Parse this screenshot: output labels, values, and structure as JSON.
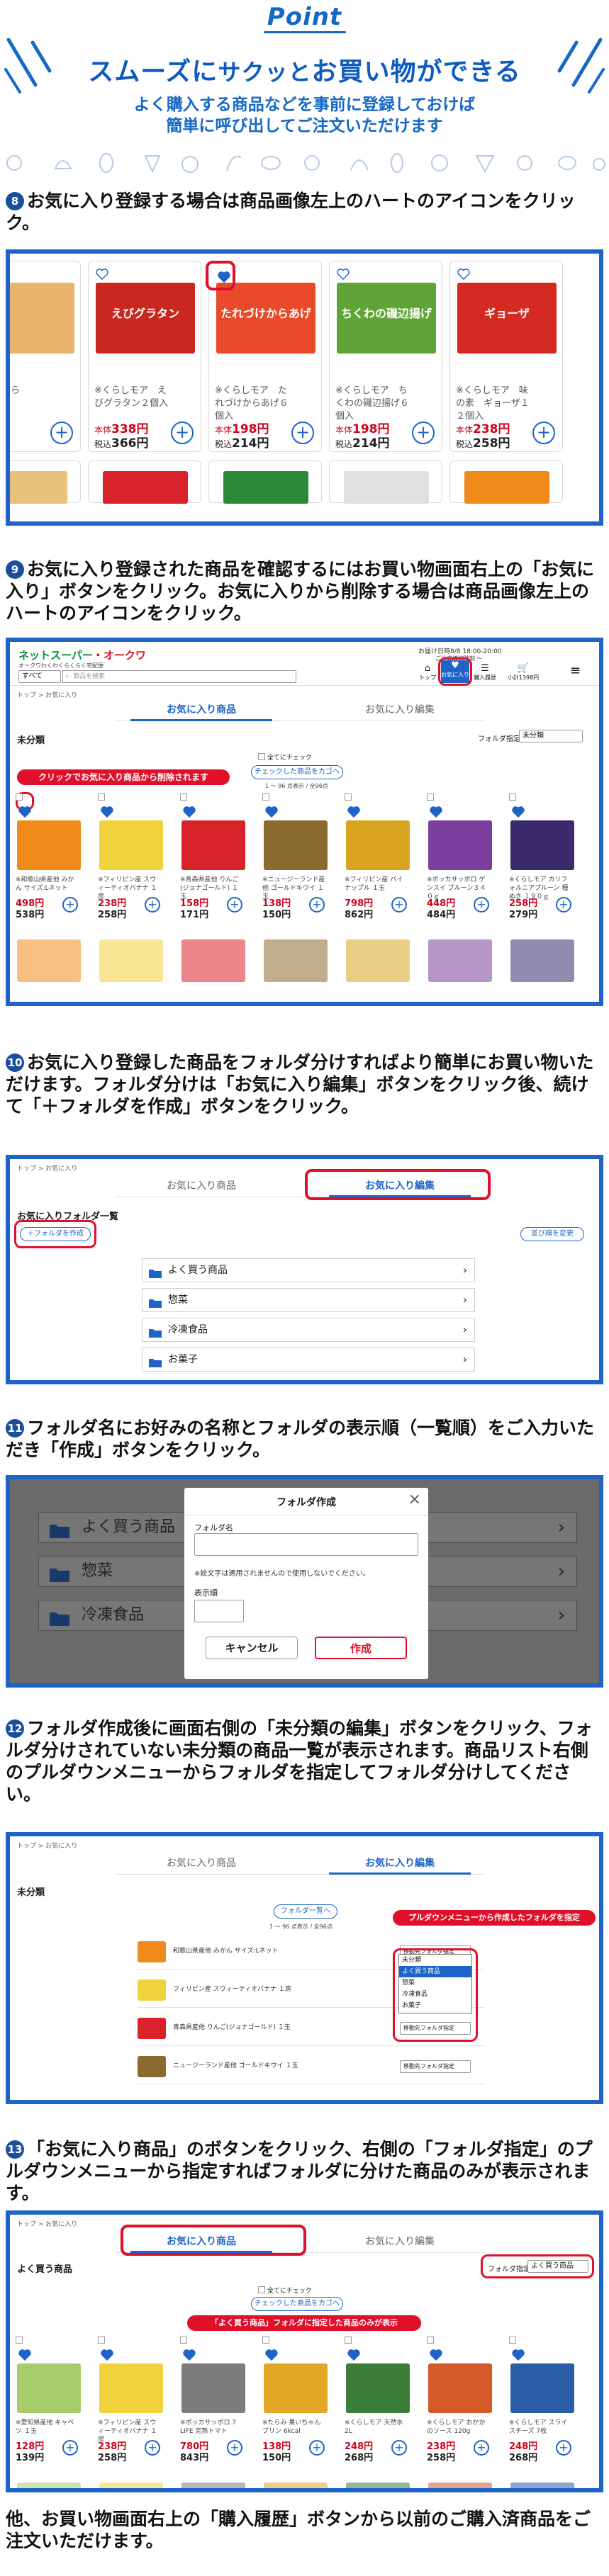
{
  "hero": {
    "point": "Point",
    "title_a": "スムーズに",
    "title_b": "サクッ",
    "title_c": "と",
    "title_d": "お買い物ができる",
    "sub1": "よく購入する商品などを事前に登録しておけば",
    "sub2": "簡単に呼び出してご注文いただけます"
  },
  "step8": {
    "num": "8",
    "text": "お気に入り登録する場合は商品画像左上のハートのアイコンをクリック。",
    "products": [
      {
        "name": "いか天ぷら",
        "p1": "",
        "p2": "",
        "color": "#e8b36a"
      },
      {
        "name": "※くらしモア　えびグラタン２個入",
        "p1": "338円",
        "p2": "366円",
        "color": "#c8281f",
        "img_label": "えびグラタン"
      },
      {
        "name": "※くらしモア　たれづけからあげ６個入",
        "p1": "198円",
        "p2": "214円",
        "color": "#e94a2a",
        "img_label": "たれづけからあげ"
      },
      {
        "name": "※くらしモア　ちくわの磯辺揚げ６個入",
        "p1": "198円",
        "p2": "214円",
        "color": "#5fa436",
        "img_label": "ちくわの磯辺揚げ"
      },
      {
        "name": "※くらしモア　味の素　ギョーザ１２個入",
        "p1": "238円",
        "p2": "258円",
        "color": "#d52a22",
        "img_label": "ギョーザ"
      }
    ],
    "price_label1": "本体",
    "price_label2": "税込"
  },
  "step9": {
    "num": "9",
    "text": "お気に入り登録された商品を確認するにはお買い物画面右上の「お気に入り」ボタンをクリック。お気に入りから削除する場合は商品画像左上のハートのアイコンをクリック。",
    "logo_a": "ネットスーパー",
    "logo_b": "・オークワ",
    "logo_sub": "オークワわくわくらくらく宅配便",
    "delivery": "お届け日時8/8 18:00-20:00",
    "delivery2": "ご注文締切時刻 ～",
    "search_cat": "すべて",
    "search_placeholder": "商品を検索",
    "nav": [
      "トップ",
      "お気に入り",
      "購入履歴",
      "小計1398円"
    ],
    "crumb": "トップ > お気に入り",
    "tab_fav": "お気に入り商品",
    "tab_edit": "お気に入り編集",
    "section": "未分類",
    "folder_label": "フォルダ指定",
    "folder_value": "未分類",
    "check_all": "全てにチェック",
    "add_checked": "チェックした商品をカゴへ",
    "count": "1 ～ 96 点表示 / 全96点",
    "callout": "クリックでお気に入り商品から削除されます",
    "items": [
      {
        "name": "※和歌山県産他 みかん サイズ:Lネット",
        "p1": "498円",
        "p2": "538円",
        "color": "#f08a1a"
      },
      {
        "name": "※フィリピン産 スウィーティオバナナ １房",
        "p1": "238円",
        "p2": "258円",
        "color": "#f2d23c"
      },
      {
        "name": "※青森県産他 りんご(ジョナゴールド) １玉",
        "p1": "158円",
        "p2": "171円",
        "color": "#d8232a"
      },
      {
        "name": "※ニュージーランド産他 ゴールドキウイ １玉",
        "p1": "138円",
        "p2": "150円",
        "color": "#8b6a2f"
      },
      {
        "name": "※フィリピン産 パイナップル １玉",
        "p1": "798円",
        "p2": "862円",
        "color": "#d9a521"
      },
      {
        "name": "※ポッカサッポロ ゲンスイ プルーン３４０ｇ",
        "p1": "448円",
        "p2": "484円",
        "color": "#7a3e9c"
      },
      {
        "name": "※くらしモア カリフォルニアプルーン 種ぬき １９０ｇ",
        "p1": "258円",
        "p2": "279円",
        "color": "#3a2a6e"
      }
    ]
  },
  "step10": {
    "num": "10",
    "text": "お気に入り登録した商品をフォルダ分けすればより簡単にお買い物いただけます。フォルダ分けは「お気に入り編集」ボタンをクリック後、続けて「＋フォルダを作成」ボタンをクリック。",
    "crumb": "トップ > お気に入り",
    "tab_fav": "お気に入り商品",
    "tab_edit": "お気に入り編集",
    "list_title": "お気に入りフォルダ一覧",
    "create": "＋フォルダを作成",
    "order": "並び順を変更",
    "folders": [
      "よく買う商品",
      "惣菜",
      "冷凍食品",
      "お菓子"
    ]
  },
  "step11": {
    "num": "11",
    "text": "フォルダ名にお好みの名称とフォルダの表示順（一覧順）をご入力いただき「作成」ボタンをクリック。",
    "bg_folders": [
      "よく買う商品",
      "惣菜",
      "冷凍食品"
    ],
    "modal_title": "フォルダ作成",
    "field_name": "フォルダ名",
    "note": "※絵文字は適用されませんので使用しないでください。",
    "field_order": "表示順",
    "cancel": "キャンセル",
    "create": "作成"
  },
  "step12": {
    "num": "12",
    "text": "フォルダ作成後に画面右側の「未分類の編集」ボタンをクリック、フォルダ分けされていない未分類の商品一覧が表示されます。商品リスト右側のプルダウンメニューからフォルダを指定してフォルダ分けしてください。",
    "crumb": "トップ > お気に入り",
    "tab_fav": "お気に入り商品",
    "tab_edit": "お気に入り編集",
    "section": "未分類",
    "back": "フォルダ一覧へ",
    "count": "1 ～ 96 点表示 / 全96点",
    "callout": "プルダウンメニューから作成したフォルダを指定",
    "rows": [
      "和歌山県産他 みかん サイズ:Lネット",
      "フィリピン産 スウィーティオバナナ １房",
      "青森県産他 りんご(ジョナゴールド) １玉",
      "ニュージーランド産他 ゴールドキウイ １玉"
    ],
    "row_colors": [
      "#f08a1a",
      "#f2d23c",
      "#d8232a",
      "#8b6a2f"
    ],
    "dropdown_value": "移動先フォルダ指定",
    "dropdown_options": [
      "未分類",
      "よく買う商品",
      "惣菜",
      "冷凍食品",
      "お菓子"
    ]
  },
  "step13": {
    "num": "13",
    "text": "「お気に入り商品」のボタンをクリック、右側の「フォルダ指定」のプルダウンメニューから指定すればフォルダに分けた商品のみが表示されます。",
    "crumb": "トップ > お気に入り",
    "tab_fav": "お気に入り商品",
    "tab_edit": "お気に入り編集",
    "section": "よく買う商品",
    "folder_label": "フォルダ指定",
    "folder_value": "よく買う商品",
    "check_all": "全てにチェック",
    "add_checked": "チェックした商品をカゴへ",
    "callout": "「よく買う商品」フォルダに指定した商品のみが表示",
    "items": [
      {
        "name": "※愛知県産他 キャベツ １玉",
        "p1": "128円",
        "p2": "139円",
        "color": "#a7cc6a"
      },
      {
        "name": "※フィリピン産 スウィーティオバナナ １房",
        "p1": "238円",
        "p2": "258円",
        "color": "#f2d23c"
      },
      {
        "name": "※ポッカサッポロ 7 LIFE 完熟トマト",
        "p1": "780円",
        "p2": "843円",
        "color": "#7c7c7c"
      },
      {
        "name": "※たらみ 果いちゃんプリン 6kcal",
        "p1": "138円",
        "p2": "150円",
        "color": "#e2a828"
      },
      {
        "name": "※くらしモア 天然水 2L",
        "p1": "248円",
        "p2": "268円",
        "color": "#3b7d3a"
      },
      {
        "name": "※くらしモア おかかのソース 120g",
        "p1": "238円",
        "p2": "258円",
        "color": "#d45a2a"
      },
      {
        "name": "※くらしモア スライスチーズ 7枚",
        "p1": "248円",
        "p2": "268円",
        "color": "#2a5fa8"
      }
    ]
  },
  "footer": {
    "text": "他、お買い物画面右上の「購入履歴」ボタンから以前のご購入済商品をご注文いただけます。"
  }
}
